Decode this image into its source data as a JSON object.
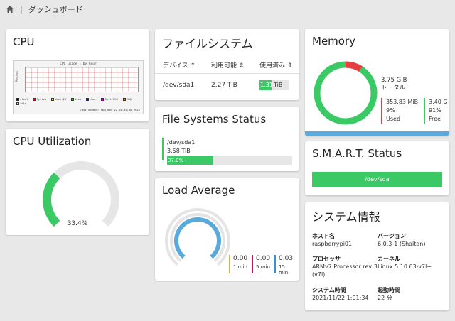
{
  "topbar": {
    "home_icon": "home-icon",
    "separator": "|",
    "title": "ダッシュボード"
  },
  "cpu": {
    "title": "CPU",
    "graph": {
      "title": "CPU usage - by hour",
      "ylabel": "Percent",
      "legend": [
        "Steal",
        "System",
        "Wait-IO",
        "Nice",
        "User",
        "Soft-IRQ",
        "IRQ",
        "Idle"
      ],
      "legend_colors": [
        "#000000",
        "#ff0000",
        "#ffff00",
        "#00ff00",
        "#0000ff",
        "#ff00ff",
        "#ff8c00",
        "#fffacd"
      ],
      "footer": "Last update: Mon Nov 22 01:35:28 2021"
    }
  },
  "cpu_util": {
    "title": "CPU Utilization",
    "value_text": "33.4%",
    "percent": 33.4
  },
  "filesystems": {
    "title": "ファイルシステム",
    "columns": {
      "device": "デバイス",
      "available": "利用可能",
      "used": "使用済み"
    },
    "rows": [
      {
        "device": "/dev/sda1",
        "available": "2.27 TiB",
        "used_value": "1.31",
        "used_unit": "TiB",
        "used_percent": 37
      }
    ]
  },
  "fs_status": {
    "title": "File Systems Status",
    "device": "/dev/sda1",
    "size": "3.58 TiB",
    "percent_text": "37.0%",
    "percent": 37.0
  },
  "load": {
    "title": "Load Average",
    "items": [
      {
        "value": "0.00",
        "label": "1 min",
        "color": "#f5a623"
      },
      {
        "value": "0.00",
        "label": "5 min",
        "color": "#c2185b"
      },
      {
        "value": "0.03",
        "label": "15 min",
        "color": "#3b8fd6"
      }
    ]
  },
  "memory": {
    "title": "Memory",
    "total_value": "3.75 GiB",
    "total_label": "トータル",
    "used": {
      "value": "353.83 MiB",
      "percent": "9%",
      "label": "Used"
    },
    "free": {
      "value": "3.40 G",
      "percent": "91%",
      "label": "Free"
    },
    "used_fraction": 0.09,
    "colors": {
      "used": "#e84040",
      "free": "#3ac964"
    }
  },
  "smart": {
    "title": "S.M.A.R.T. Status",
    "device": "/dev/sda"
  },
  "sysinfo": {
    "title": "システム情報",
    "fields": [
      {
        "label": "ホスト名",
        "value": "raspberrypi01"
      },
      {
        "label": "バージョン",
        "value": "6.0.3-1 (Shaitan)"
      },
      {
        "label": "プロセッサ",
        "value": "ARMv7 Processor rev 3 (v7l)"
      },
      {
        "label": "カーネル",
        "value": "Linux 5.10.63-v7l+"
      },
      {
        "label": "システム時間",
        "value": "2021/11/22 1:01:34"
      },
      {
        "label": "起動時間",
        "value": "22 分"
      }
    ]
  },
  "colors": {
    "accent": "#3ac964",
    "blue": "#5aa9dc",
    "background": "#e8e8e8"
  }
}
